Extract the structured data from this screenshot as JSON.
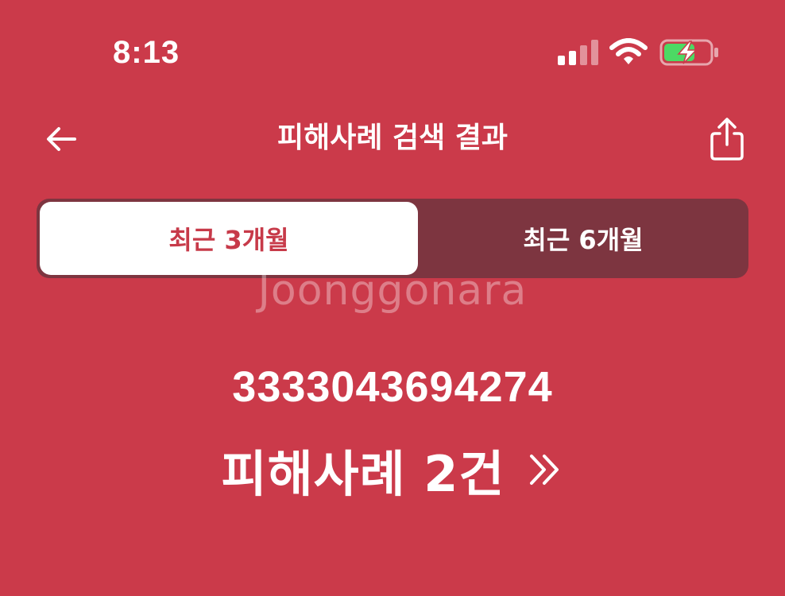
{
  "status_bar": {
    "time": "8:13",
    "signal_icon": "cellular-signal-icon",
    "wifi_icon": "wifi-icon",
    "battery_icon": "battery-charging-icon",
    "battery_color": "#4cd964"
  },
  "nav": {
    "back_icon": "arrow-left-icon",
    "title": "피해사례 검색 결과",
    "share_icon": "share-icon"
  },
  "tabs": [
    {
      "label": "최근 3개월",
      "selected": true
    },
    {
      "label": "최근 6개월",
      "selected": false
    }
  ],
  "watermark": "Joonggonara",
  "result": {
    "account_number": "3333043694274",
    "label": "피해사례 2건",
    "chevron_icon": "double-chevron-right-icon"
  },
  "colors": {
    "background": "#cb3a4a",
    "segment_bg": "#7d3540",
    "accent_text": "#c73a49"
  }
}
